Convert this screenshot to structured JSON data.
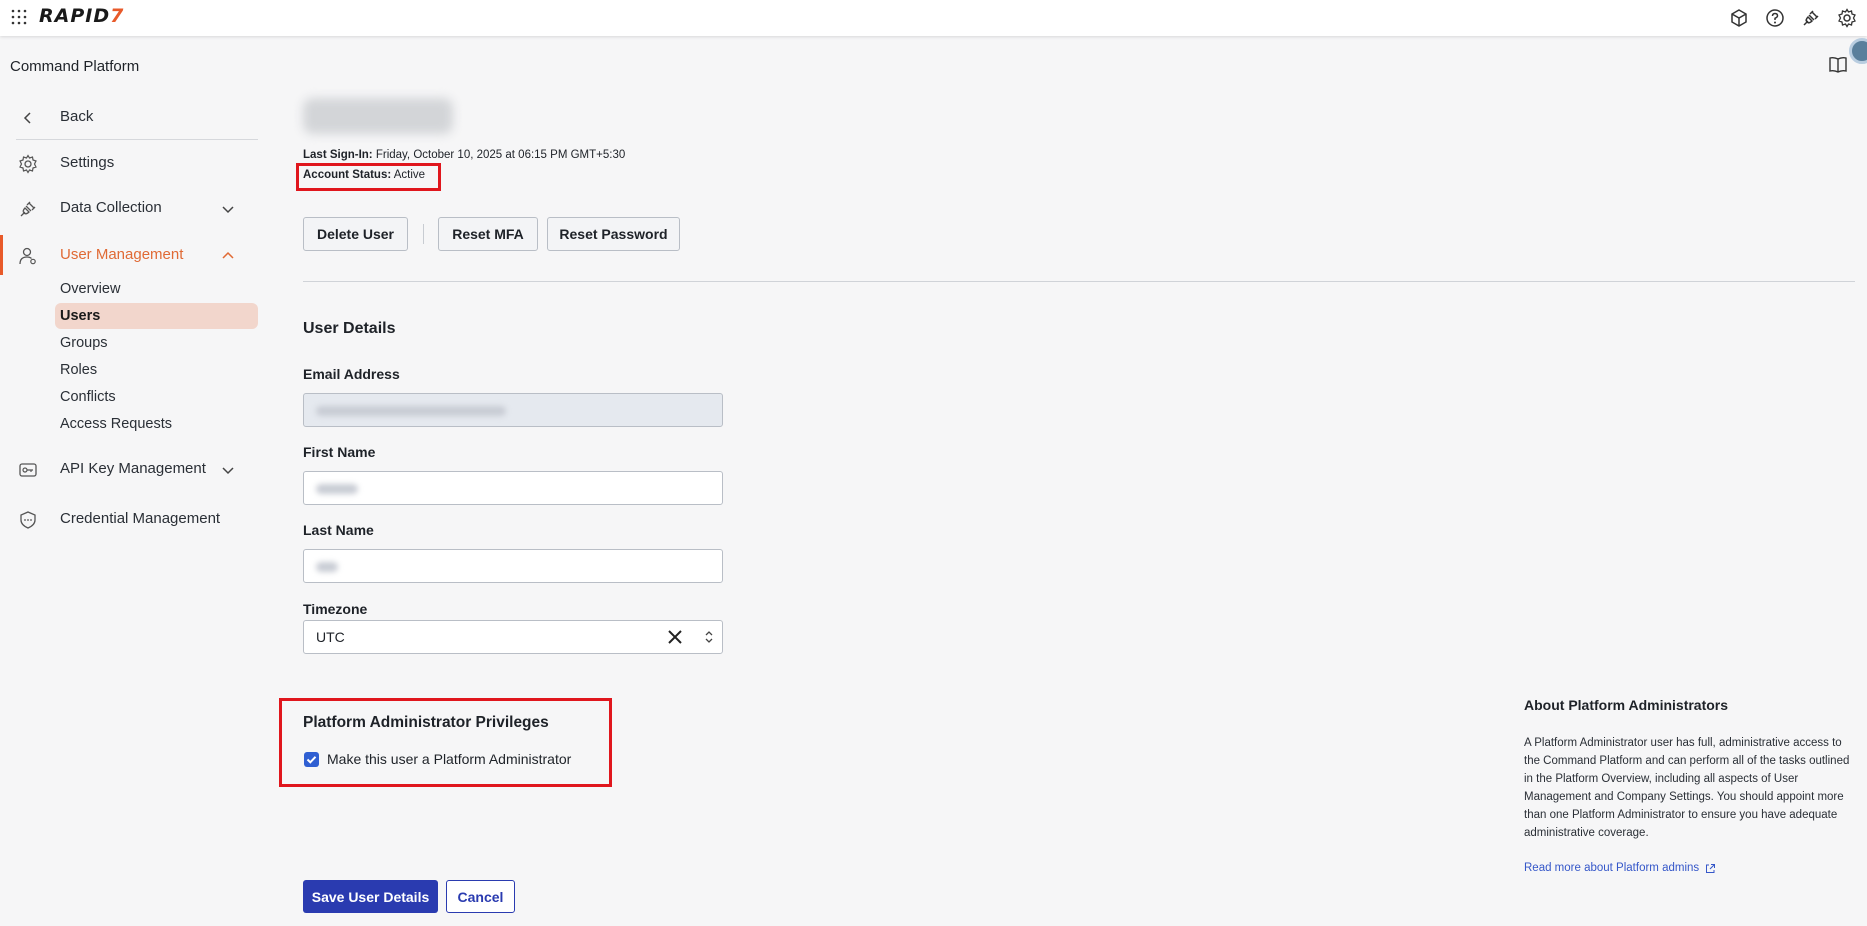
{
  "topbar": {
    "logo_main": "RAPID",
    "logo_accent": "7"
  },
  "sidebar": {
    "title": "Command Platform",
    "back": "Back",
    "items": [
      {
        "label": "Settings"
      },
      {
        "label": "Data Collection"
      },
      {
        "label": "User Management"
      },
      {
        "label": "API Key Management"
      },
      {
        "label": "Credential Management"
      }
    ],
    "user_mgmt_sub": [
      "Overview",
      "Users",
      "Groups",
      "Roles",
      "Conflicts",
      "Access Requests"
    ]
  },
  "user": {
    "last_signin_label": "Last Sign-In:",
    "last_signin_value": " Friday, October 10, 2025 at 06:15 PM GMT+5:30",
    "status_label": "Account Status:",
    "status_value": " Active"
  },
  "actions": {
    "delete": "Delete User",
    "reset_mfa": "Reset MFA",
    "reset_password": "Reset Password"
  },
  "details": {
    "title": "User Details",
    "email_label": "Email Address",
    "first_name_label": "First Name",
    "last_name_label": "Last Name",
    "timezone_label": "Timezone",
    "timezone_value": "UTC"
  },
  "privileges": {
    "title": "Platform Administrator Privileges",
    "checkbox_label": "Make this user a Platform Administrator",
    "checked": true
  },
  "footer": {
    "save": "Save User Details",
    "cancel": "Cancel"
  },
  "about": {
    "title": "About Platform Administrators",
    "body": "A Platform Administrator user has full, administrative access to the Command Platform and can perform all of the tasks outlined in the Platform Overview, including all aspects of User Management and Company Settings. You should appoint more than one Platform Administrator to ensure you have adequate administrative coverage.",
    "link": "Read more about Platform admins"
  },
  "colors": {
    "accent": "#e85a2a",
    "primary": "#2a3bb0",
    "highlight": "#e0161d"
  }
}
